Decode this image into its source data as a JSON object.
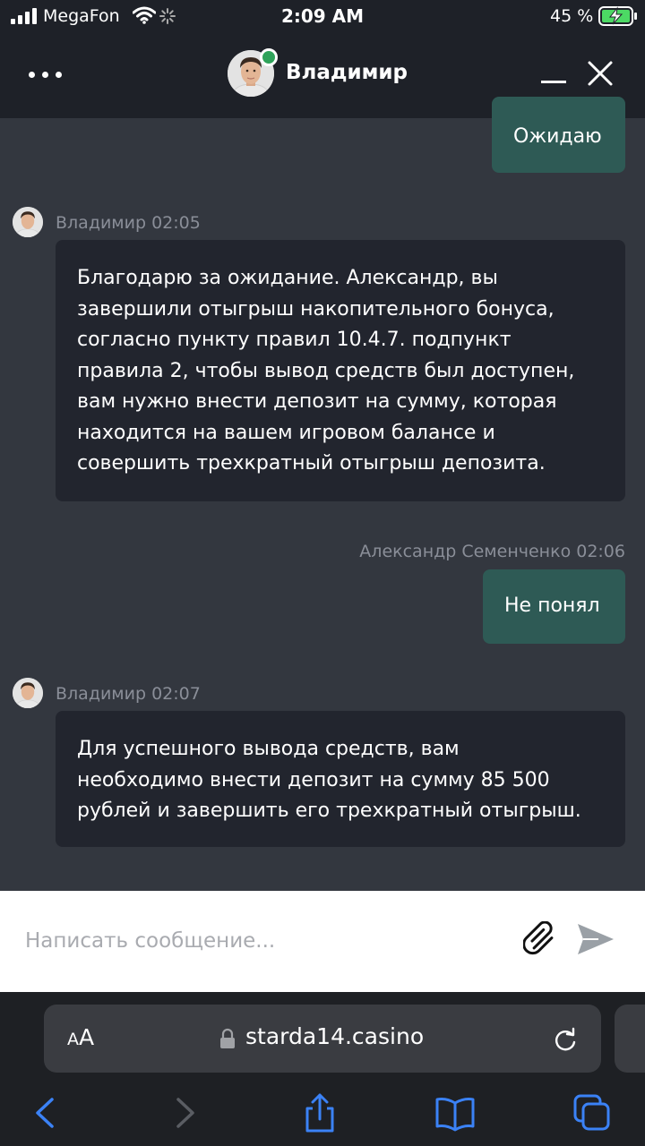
{
  "status_bar": {
    "carrier": "MegaFon",
    "time": "2:09 AM",
    "battery_percent": "45 %"
  },
  "header": {
    "agent_name": "Владимир"
  },
  "messages": [
    {
      "direction": "outgoing",
      "text": "Ожидаю"
    },
    {
      "direction": "incoming",
      "meta": "Владимир 02:05",
      "lines": [
        "Благодарю за ожидание. Александр, вы",
        "завершили отыгрыш накопительного бонуса,",
        "согласно пункту правил 10.4.7. подпункт",
        "правила 2, чтобы вывод средств был доступен,",
        "вам нужно внести депозит на сумму, которая",
        "находится на вашем игровом балансе и",
        "совершить трехкратный отыгрыш депозита."
      ]
    },
    {
      "direction": "outgoing",
      "meta": "Александр Семенченко 02:06",
      "text": "Не понял"
    },
    {
      "direction": "incoming",
      "meta": "Владимир 02:07",
      "lines": [
        "Для успешного вывода средств, вам",
        "необходимо внести депозит на сумму 85 500",
        "рублей и завершить его трехкратный отыгрыш."
      ]
    }
  ],
  "composer": {
    "placeholder": "Написать сообщение..."
  },
  "browser": {
    "text_size_label_small": "A",
    "text_size_label_big": "A",
    "url": "starda14.casino"
  },
  "colors": {
    "chat_background": "#33373f",
    "header_background": "#1e2128",
    "incoming_bubble": "#22252e",
    "outgoing_bubble": "#2e5a55",
    "online_indicator": "#2fa35a",
    "browser_chrome": "#1e2024",
    "browser_accent": "#3b82f6"
  },
  "icons": [
    "cellular-signal-icon",
    "wifi-icon",
    "loading-spinner-icon",
    "battery-charging-icon",
    "more-dots-icon",
    "minimize-icon",
    "close-icon",
    "paperclip-icon",
    "send-icon",
    "lock-icon",
    "reload-icon",
    "back-icon",
    "forward-icon",
    "share-icon",
    "bookmarks-icon",
    "tabs-icon"
  ]
}
